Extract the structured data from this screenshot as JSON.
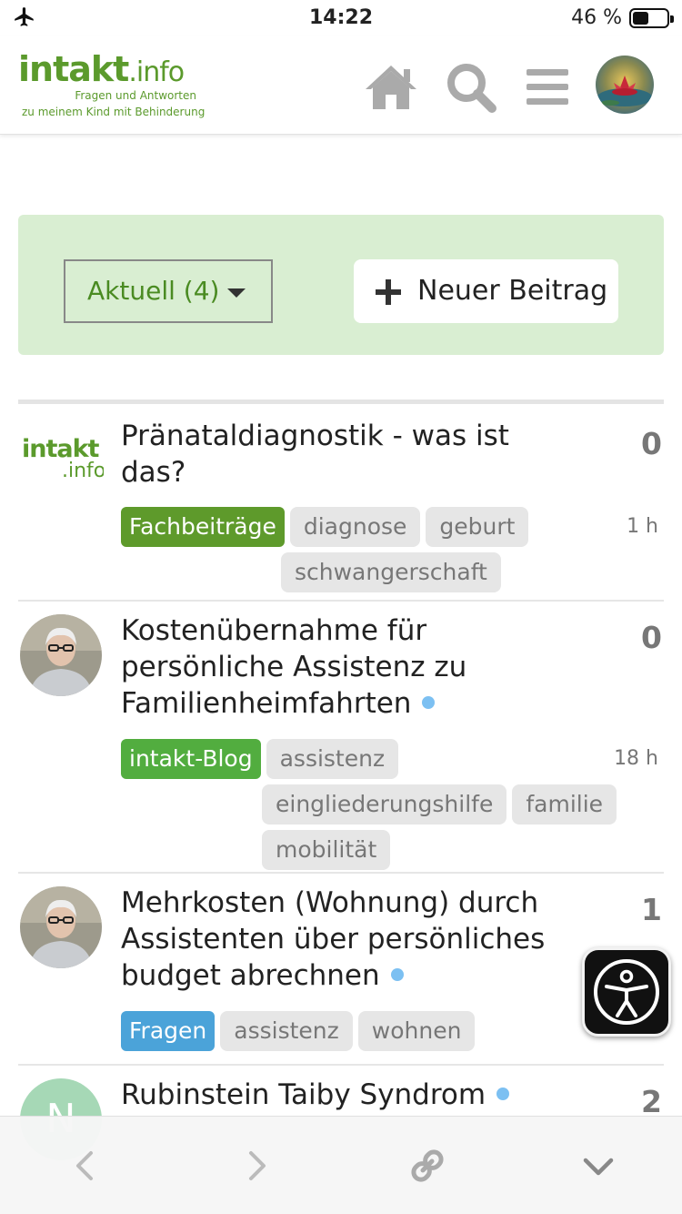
{
  "status_bar": {
    "time": "14:22",
    "battery_percent": "46 %",
    "battery_level": 0.46,
    "airplane_icon": "airplane-icon"
  },
  "header": {
    "logo": {
      "brand_main": "intakt",
      "brand_suffix": ".info",
      "tagline_line1": "Fragen und Antworten",
      "tagline_line2": "zu meinem Kind mit Behinderung"
    },
    "icons": [
      "home-icon",
      "search-icon",
      "menu-icon"
    ],
    "brand_color": "#5b9a2c"
  },
  "filter": {
    "dropdown_label": "Aktuell (4)",
    "new_topic_label": "Neuer Beitrag",
    "panel_color": "#d9eed2"
  },
  "topics": [
    {
      "title": "Pränataldiagnostik - was ist das?",
      "replies": "0",
      "age": "1 h",
      "category": {
        "name": "Fachbeiträge",
        "color": "#5e9a2b"
      },
      "tags": [
        "diagnose",
        "geburt",
        "schwangerschaft"
      ],
      "unread": false,
      "avatar_text_main": "intakt",
      "avatar_text_suffix": ".info"
    },
    {
      "title": "Kostenübernahme für persönliche Assistenz zu Familienheimfahrten",
      "replies": "0",
      "age": "18 h",
      "category": {
        "name": "intakt-Blog",
        "color": "#52ad3f"
      },
      "tags": [
        "assistenz",
        "eingliederungshilfe",
        "familie",
        "mobilität"
      ],
      "unread": true
    },
    {
      "title": "Mehrkosten (Wohnung) durch Assistenten über persönliches budget abrechnen",
      "replies": "1",
      "age": "",
      "category": {
        "name": "Fragen",
        "color": "#4ba3d9"
      },
      "tags": [
        "assistenz",
        "wohnen"
      ],
      "unread": true
    },
    {
      "title": "Rubinstein Taiby Syndrom",
      "replies": "2",
      "age": "",
      "avatar_letter": "N",
      "avatar_color": "#a6d8b6",
      "unread": true
    }
  ],
  "bottom_bar": {
    "icons": [
      "back-chevron-icon",
      "forward-chevron-icon",
      "link-icon",
      "collapse-chevron-icon"
    ]
  }
}
